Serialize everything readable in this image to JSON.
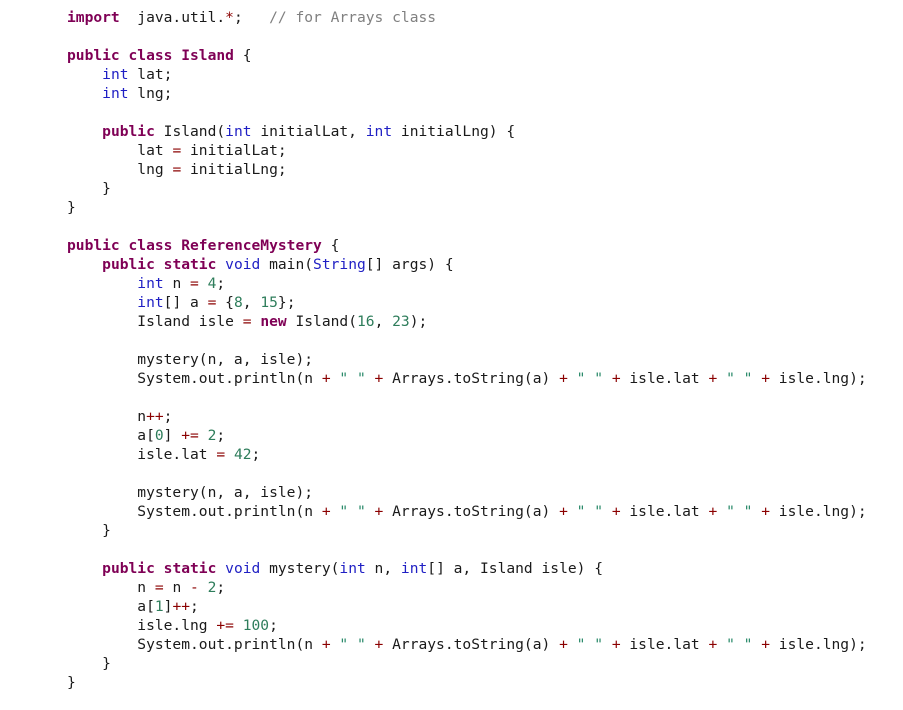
{
  "editor": {
    "language": "java",
    "colors": {
      "keyword": "#7f0055",
      "type": "#1f1fc4",
      "number": "#2e7d5b",
      "string": "#2a8a6a",
      "operator": "#8b0000",
      "comment": "#808080",
      "text": "#1a1a1a"
    },
    "lines": [
      [
        [
          "kw",
          "import"
        ],
        [
          "",
          "  java.util."
        ],
        [
          "op",
          "*"
        ],
        [
          "",
          ";   "
        ],
        [
          "cm",
          "// for Arrays class"
        ]
      ],
      [],
      [
        [
          "kw",
          "public class"
        ],
        [
          "",
          ""
        ],
        [
          "kw",
          " Island"
        ],
        [
          "",
          " {"
        ]
      ],
      [
        [
          "",
          "    "
        ],
        [
          "ty",
          "int"
        ],
        [
          "",
          " lat;"
        ]
      ],
      [
        [
          "",
          "    "
        ],
        [
          "ty",
          "int"
        ],
        [
          "",
          " lng;"
        ]
      ],
      [],
      [
        [
          "",
          "    "
        ],
        [
          "kw",
          "public"
        ],
        [
          "",
          " Island("
        ],
        [
          "ty",
          "int"
        ],
        [
          "",
          " initialLat, "
        ],
        [
          "ty",
          "int"
        ],
        [
          "",
          " initialLng) {"
        ]
      ],
      [
        [
          "",
          "        lat "
        ],
        [
          "op",
          "="
        ],
        [
          "",
          " initialLat;"
        ]
      ],
      [
        [
          "",
          "        lng "
        ],
        [
          "op",
          "="
        ],
        [
          "",
          " initialLng;"
        ]
      ],
      [
        [
          "",
          "    }"
        ]
      ],
      [
        [
          "",
          "}"
        ]
      ],
      [],
      [
        [
          "kw",
          "public class"
        ],
        [
          "kw",
          " ReferenceMystery"
        ],
        [
          "",
          " {"
        ]
      ],
      [
        [
          "",
          "    "
        ],
        [
          "kw",
          "public static"
        ],
        [
          "ty",
          " void"
        ],
        [
          "",
          " main("
        ],
        [
          "ty",
          "String"
        ],
        [
          "",
          "[] args) {"
        ]
      ],
      [
        [
          "",
          "        "
        ],
        [
          "ty",
          "int"
        ],
        [
          "",
          " n "
        ],
        [
          "op",
          "="
        ],
        [
          "num",
          " 4"
        ],
        [
          "",
          ";"
        ]
      ],
      [
        [
          "",
          "        "
        ],
        [
          "ty",
          "int"
        ],
        [
          "",
          "[] a "
        ],
        [
          "op",
          "="
        ],
        [
          "",
          " {"
        ],
        [
          "num",
          "8"
        ],
        [
          "",
          ", "
        ],
        [
          "num",
          "15"
        ],
        [
          "",
          "};"
        ]
      ],
      [
        [
          "",
          "        Island isle "
        ],
        [
          "op",
          "="
        ],
        [
          "kw",
          " new"
        ],
        [
          "",
          " Island("
        ],
        [
          "num",
          "16"
        ],
        [
          "",
          ", "
        ],
        [
          "num",
          "23"
        ],
        [
          "",
          ");"
        ]
      ],
      [],
      [
        [
          "",
          "        mystery(n, a, isle);"
        ]
      ],
      [
        [
          "",
          "        System.out.println(n "
        ],
        [
          "op",
          "+"
        ],
        [
          "str",
          " \" \""
        ],
        [
          "op",
          " +"
        ],
        [
          "",
          " Arrays.toString(a) "
        ],
        [
          "op",
          "+"
        ],
        [
          "str",
          " \" \""
        ],
        [
          "op",
          " +"
        ],
        [
          "",
          " isle.lat "
        ],
        [
          "op",
          "+"
        ],
        [
          "str",
          " \" \""
        ],
        [
          "op",
          " +"
        ],
        [
          "",
          " isle.lng);"
        ]
      ],
      [],
      [
        [
          "",
          "        n"
        ],
        [
          "op",
          "++"
        ],
        [
          "",
          ";"
        ]
      ],
      [
        [
          "",
          "        a["
        ],
        [
          "num",
          "0"
        ],
        [
          "",
          "] "
        ],
        [
          "op",
          "+="
        ],
        [
          "num",
          " 2"
        ],
        [
          "",
          ";"
        ]
      ],
      [
        [
          "",
          "        isle.lat "
        ],
        [
          "op",
          "="
        ],
        [
          "num",
          " 42"
        ],
        [
          "",
          ";"
        ]
      ],
      [],
      [
        [
          "",
          "        mystery(n, a, isle);"
        ]
      ],
      [
        [
          "",
          "        System.out.println(n "
        ],
        [
          "op",
          "+"
        ],
        [
          "str",
          " \" \""
        ],
        [
          "op",
          " +"
        ],
        [
          "",
          " Arrays.toString(a) "
        ],
        [
          "op",
          "+"
        ],
        [
          "str",
          " \" \""
        ],
        [
          "op",
          " +"
        ],
        [
          "",
          " isle.lat "
        ],
        [
          "op",
          "+"
        ],
        [
          "str",
          " \" \""
        ],
        [
          "op",
          " +"
        ],
        [
          "",
          " isle.lng);"
        ]
      ],
      [
        [
          "",
          "    }"
        ]
      ],
      [],
      [
        [
          "",
          "    "
        ],
        [
          "kw",
          "public static"
        ],
        [
          "ty",
          " void"
        ],
        [
          "",
          " mystery("
        ],
        [
          "ty",
          "int"
        ],
        [
          "",
          " n, "
        ],
        [
          "ty",
          "int"
        ],
        [
          "",
          "[] a, Island isle) {"
        ]
      ],
      [
        [
          "",
          "        n "
        ],
        [
          "op",
          "="
        ],
        [
          "",
          " n "
        ],
        [
          "op",
          "-"
        ],
        [
          "num",
          " 2"
        ],
        [
          "",
          ";"
        ]
      ],
      [
        [
          "",
          "        a["
        ],
        [
          "num",
          "1"
        ],
        [
          "",
          "]"
        ],
        [
          "op",
          "++"
        ],
        [
          "",
          ";"
        ]
      ],
      [
        [
          "",
          "        isle.lng "
        ],
        [
          "op",
          "+="
        ],
        [
          "num",
          " 100"
        ],
        [
          "",
          ";"
        ]
      ],
      [
        [
          "",
          "        System.out.println(n "
        ],
        [
          "op",
          "+"
        ],
        [
          "str",
          " \" \""
        ],
        [
          "op",
          " +"
        ],
        [
          "",
          " Arrays.toString(a) "
        ],
        [
          "op",
          "+"
        ],
        [
          "str",
          " \" \""
        ],
        [
          "op",
          " +"
        ],
        [
          "",
          " isle.lat "
        ],
        [
          "op",
          "+"
        ],
        [
          "str",
          " \" \""
        ],
        [
          "op",
          " +"
        ],
        [
          "",
          " isle.lng);"
        ]
      ],
      [
        [
          "",
          "    }"
        ]
      ],
      [
        [
          "",
          "}"
        ]
      ]
    ]
  }
}
